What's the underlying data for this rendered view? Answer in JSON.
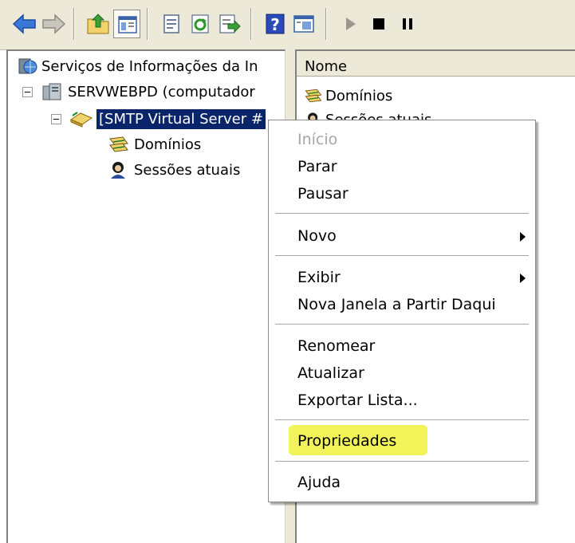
{
  "toolbar": {
    "buttons": [
      {
        "name": "back-arrow-icon"
      },
      {
        "name": "forward-arrow-icon"
      },
      {
        "name": "up-folder-icon"
      },
      {
        "name": "show-hide-tree-icon"
      },
      {
        "name": "properties-icon"
      },
      {
        "name": "refresh-icon"
      },
      {
        "name": "export-list-icon"
      },
      {
        "name": "help-icon"
      },
      {
        "name": "console-tree-icon"
      },
      {
        "name": "start-icon"
      },
      {
        "name": "stop-icon"
      },
      {
        "name": "pause-icon"
      }
    ]
  },
  "tree": {
    "root_label": "Serviços de Informações da In",
    "computer_label": "SERVWEBPD (computador",
    "server_label": "[SMTP Virtual Server #",
    "domains_label": "Domínios",
    "sessions_label": "Sessões atuais"
  },
  "list": {
    "column_name": "Nome",
    "items": [
      "Domínios",
      "Sessões atuais"
    ]
  },
  "context_menu": {
    "items": {
      "inicio": "Início",
      "parar": "Parar",
      "pausar": "Pausar",
      "novo": "Novo",
      "exibir": "Exibir",
      "nova_janela": "Nova Janela a Partir Daqui",
      "renomear": "Renomear",
      "atualizar": "Atualizar",
      "exportar": "Exportar Lista...",
      "propriedades": "Propriedades",
      "ajuda": "Ajuda"
    }
  },
  "colors": {
    "selection": "#0a246a",
    "highlight_marker": "#f0f03c",
    "toolbar_bg": "#ece9d8"
  }
}
